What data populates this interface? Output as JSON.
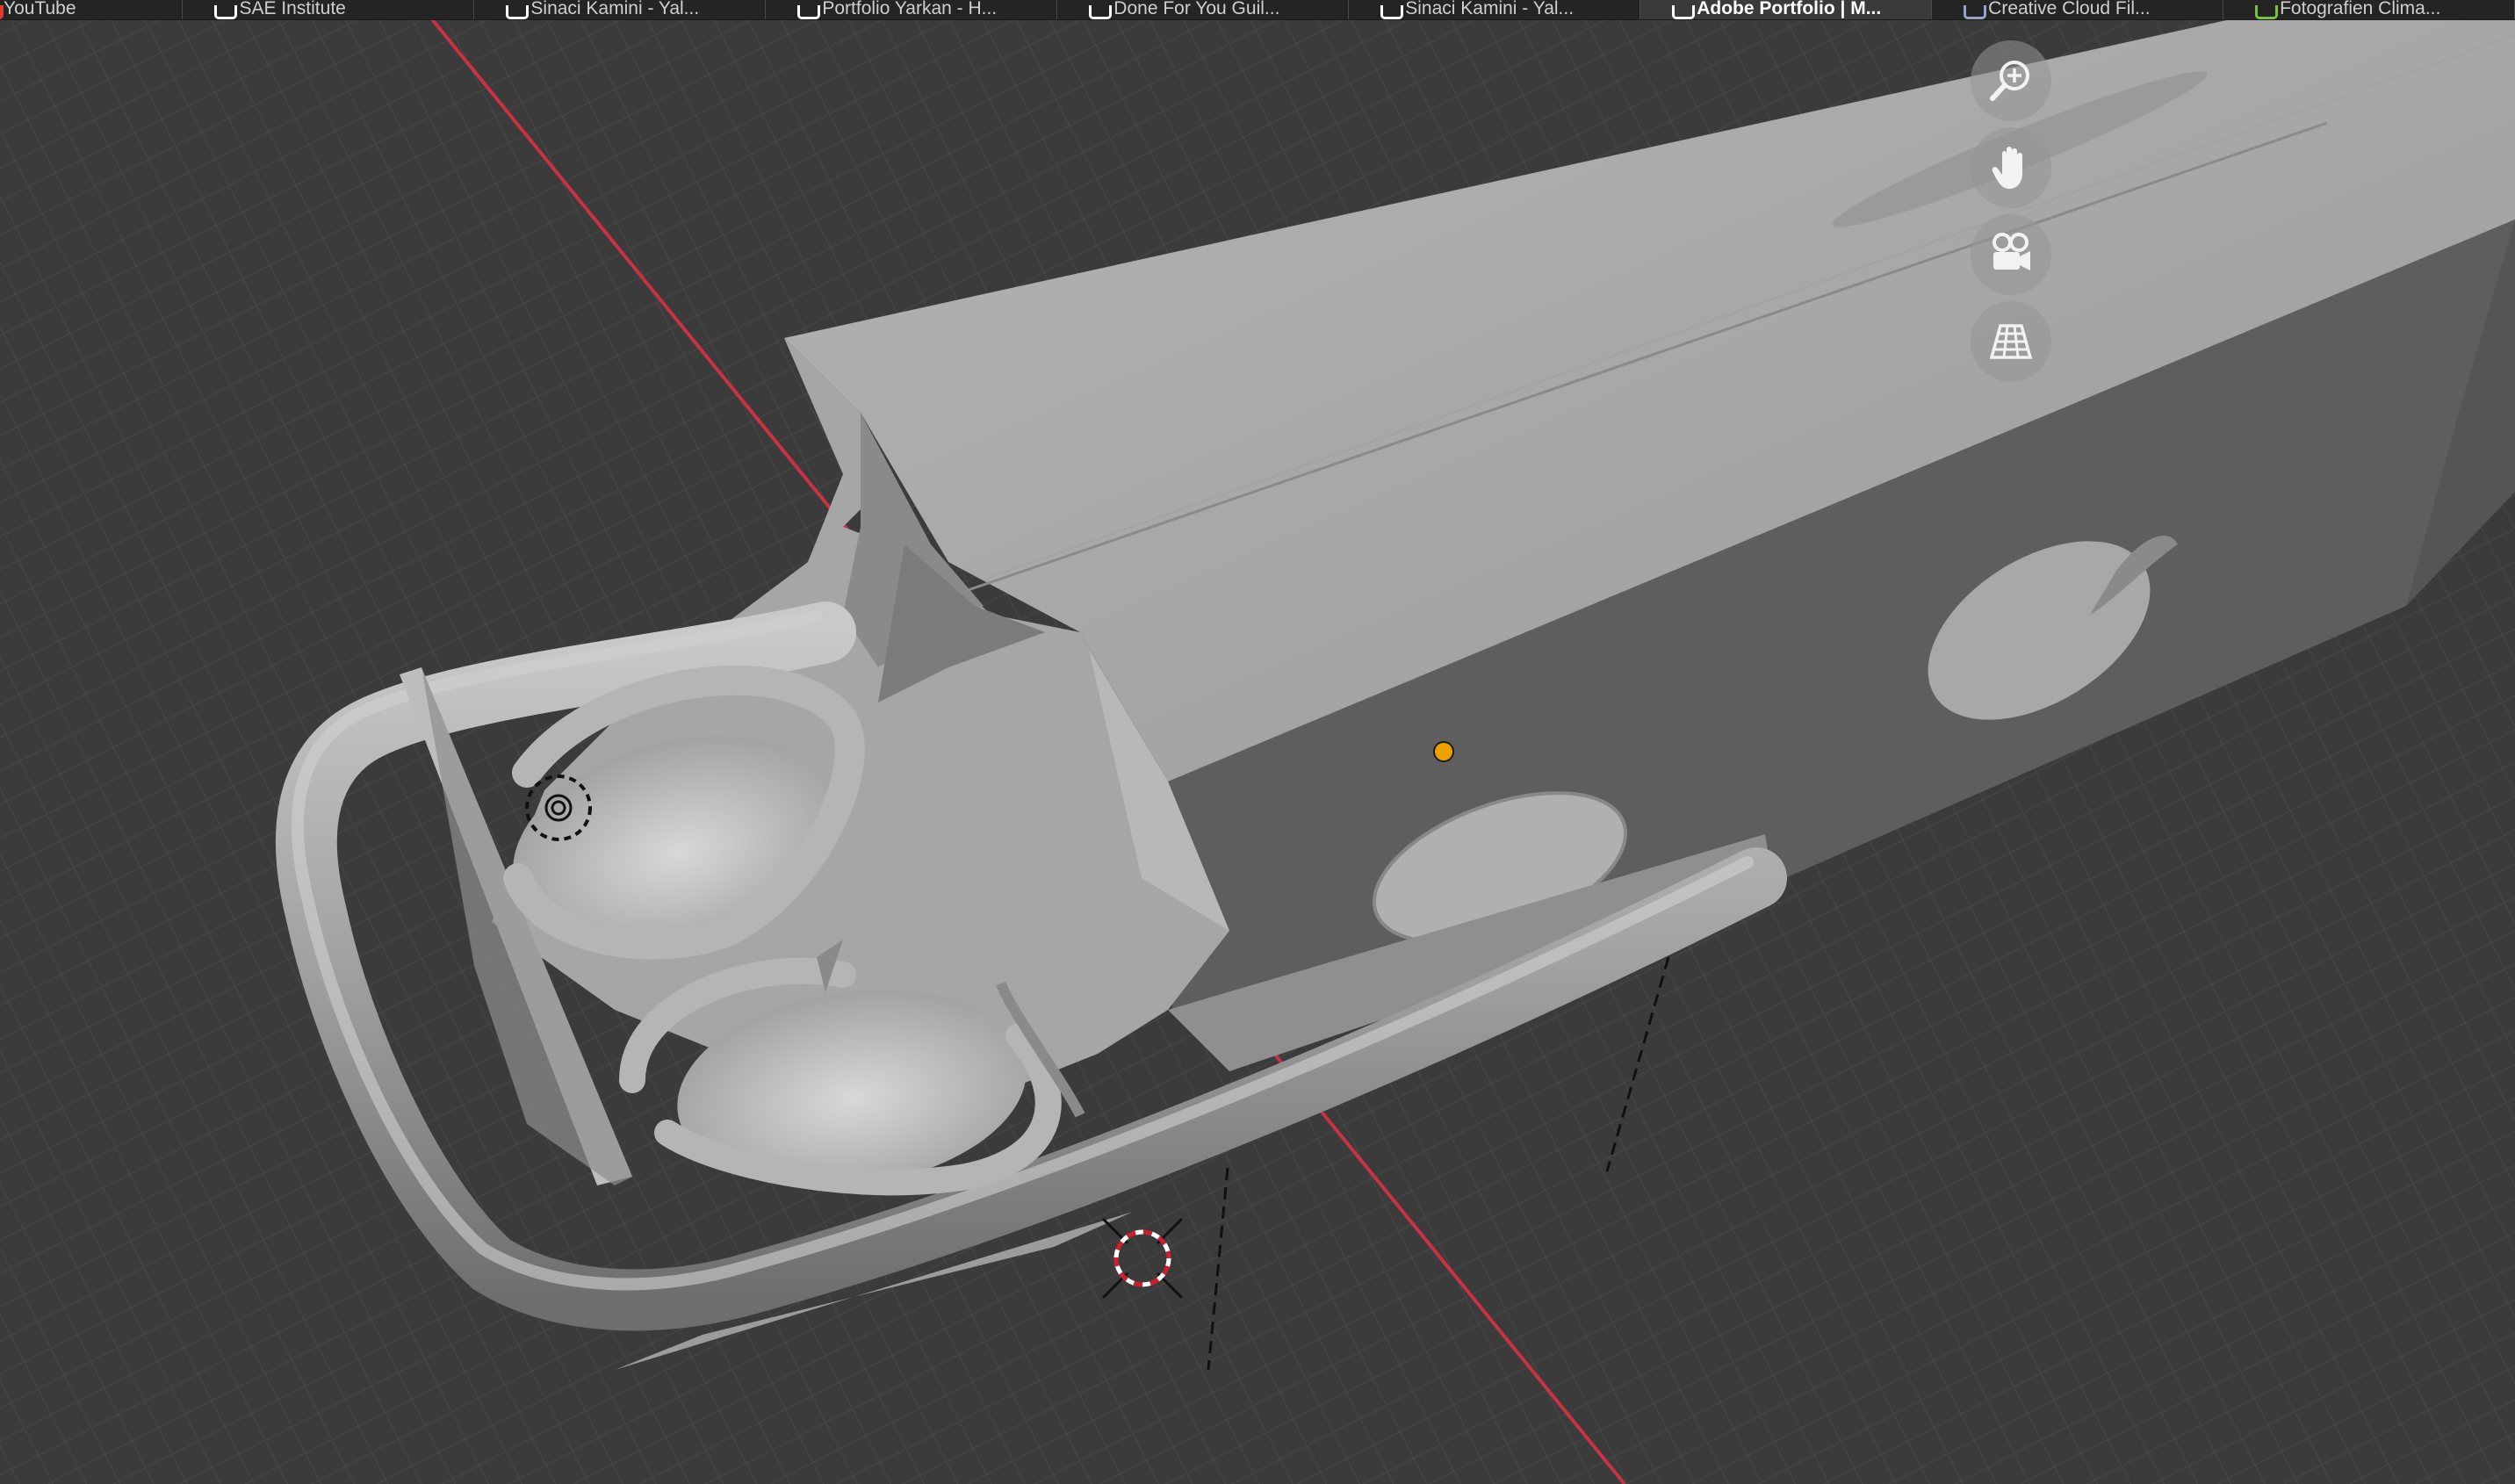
{
  "browser": {
    "tabs": [
      {
        "title": "YouTube",
        "favicon": "youtube-icon",
        "active": false
      },
      {
        "title": "SAE Institute",
        "favicon": "sae-icon",
        "active": false
      },
      {
        "title": "Sinaci Kamini - Yal...",
        "favicon": "instagram-icon",
        "active": false
      },
      {
        "title": "Portfolio Yarkan - H...",
        "favicon": "info-icon",
        "active": false
      },
      {
        "title": "Done For You Guil...",
        "favicon": "document-icon",
        "active": false
      },
      {
        "title": "Sinaci Kamini - Yal...",
        "favicon": "instagram-icon",
        "active": false
      },
      {
        "title": "Adobe Portfolio | M...",
        "favicon": "adobe-portfolio-icon",
        "active": true
      },
      {
        "title": "Creative Cloud Fil...",
        "favicon": "creative-cloud-icon",
        "active": false
      },
      {
        "title": "Fotografien Clima...",
        "favicon": "photo-icon",
        "active": false
      }
    ]
  },
  "viewport": {
    "navigation": [
      {
        "name": "zoom",
        "icon": "zoom-in-icon"
      },
      {
        "name": "pan",
        "icon": "hand-icon"
      },
      {
        "name": "camera",
        "icon": "camera-icon"
      },
      {
        "name": "projection",
        "icon": "grid-icon"
      }
    ],
    "colors": {
      "background": "#3b3b3b",
      "grid": "#474747",
      "x_axis": "#c83242",
      "mesh_light": "#a9a9a9",
      "mesh_dark": "#5e5e5e",
      "origin": "#f0a000"
    }
  }
}
